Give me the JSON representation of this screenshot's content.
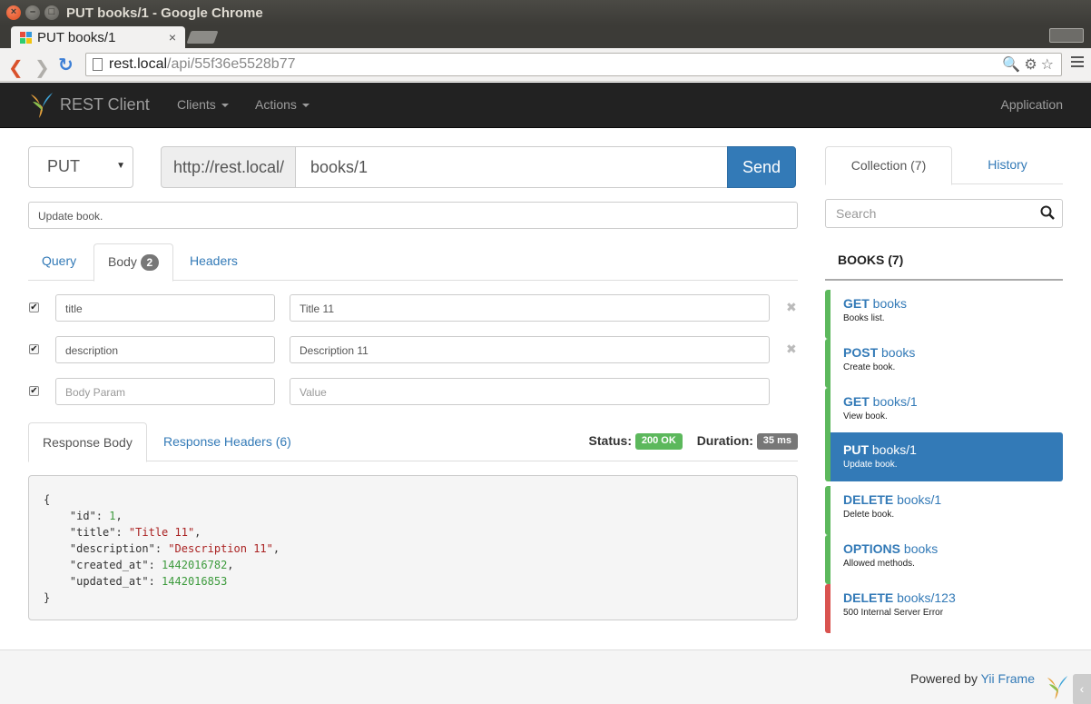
{
  "window": {
    "title": "PUT books/1 - Google Chrome"
  },
  "browser": {
    "tab_title": "PUT books/1",
    "tab_close": "×",
    "url_host": "rest.local",
    "url_path": "/api/55f36e5528b77"
  },
  "navbar": {
    "brand": "REST Client",
    "clients": "Clients",
    "actions": "Actions",
    "application": "Application"
  },
  "request": {
    "method": "PUT",
    "base_url": "http://rest.local/",
    "endpoint": "books/1",
    "send_label": "Send",
    "description": "Update book."
  },
  "request_tabs": {
    "query": "Query",
    "body": "Body",
    "body_count": "2",
    "headers": "Headers"
  },
  "body_params": [
    {
      "key": "title",
      "value": "Title 11",
      "checked": true
    },
    {
      "key": "description",
      "value": "Description 11",
      "checked": true
    }
  ],
  "new_param": {
    "key_placeholder": "Body Param",
    "value_placeholder": "Value"
  },
  "response": {
    "tab_body": "Response Body",
    "tab_headers": "Response Headers (6)",
    "status_label": "Status:",
    "status_value": "200 OK",
    "duration_label": "Duration:",
    "duration_value": "35 ms",
    "json": {
      "open": "{",
      "close": "}",
      "fields": [
        {
          "key": "\"id\"",
          "value": "1",
          "type": "num",
          "comma": ","
        },
        {
          "key": "\"title\"",
          "value": "\"Title 11\"",
          "type": "str",
          "comma": ","
        },
        {
          "key": "\"description\"",
          "value": "\"Description 11\"",
          "type": "str",
          "comma": ","
        },
        {
          "key": "\"created_at\"",
          "value": "1442016782",
          "type": "num",
          "comma": ","
        },
        {
          "key": "\"updated_at\"",
          "value": "1442016853",
          "type": "num",
          "comma": ""
        }
      ]
    }
  },
  "sidebar": {
    "tab_collection": "Collection (7)",
    "tab_history": "History",
    "search_placeholder": "Search",
    "group_title": "BOOKS (7)",
    "items": [
      {
        "method": "GET",
        "path": "books",
        "desc": "Books list.",
        "state": "ok"
      },
      {
        "method": "POST",
        "path": "books",
        "desc": "Create book.",
        "state": "ok"
      },
      {
        "method": "GET",
        "path": "books/1",
        "desc": "View book.",
        "state": "ok"
      },
      {
        "method": "PUT",
        "path": "books/1",
        "desc": "Update book.",
        "state": "active"
      },
      {
        "method": "DELETE",
        "path": "books/1",
        "desc": "Delete book.",
        "state": "ok"
      },
      {
        "method": "OPTIONS",
        "path": "books",
        "desc": "Allowed methods.",
        "state": "ok"
      },
      {
        "method": "DELETE",
        "path": "books/123",
        "desc": "500 Internal Server Error",
        "state": "error"
      }
    ]
  },
  "footer": {
    "powered_by": "Powered by",
    "framework": "Yii Frame"
  },
  "colors": {
    "primary": "#337ab7",
    "success": "#5cb85c",
    "danger": "#d9534f",
    "navbar": "#222222"
  }
}
